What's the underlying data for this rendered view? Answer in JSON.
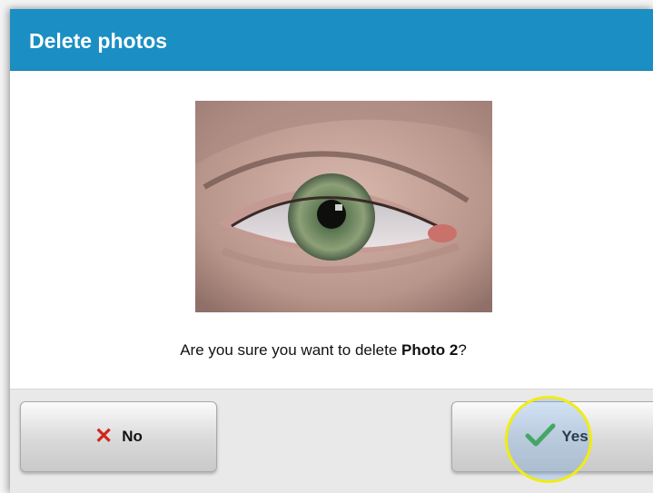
{
  "dialog": {
    "title": "Delete photos"
  },
  "photo": {
    "subject": "eye-photo"
  },
  "message": {
    "prefix": "Are you sure you want to delete ",
    "item": "Photo 2",
    "suffix": "?"
  },
  "buttons": {
    "no_label": "No",
    "yes_label": "Yes"
  },
  "colors": {
    "title_bar": "#1b8fc4",
    "no_icon": "#d0261c",
    "yes_icon": "#3aa832",
    "highlight_ring": "#f1ec12"
  }
}
